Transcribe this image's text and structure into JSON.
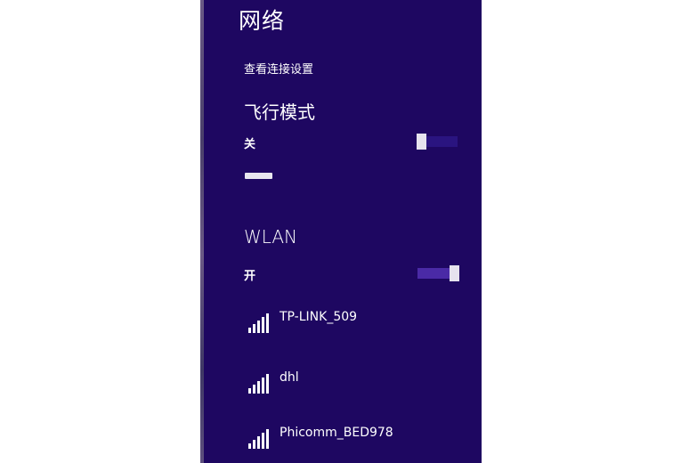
{
  "panel": {
    "title": "网络",
    "view_settings_link": "查看连接设置"
  },
  "airplane_mode": {
    "label": "飞行模式",
    "state_text": "关"
  },
  "wlan": {
    "label": "WLAN",
    "state_text": "开",
    "networks": [
      {
        "name": "TP-LINK_509",
        "icon": "wifi-signal-icon"
      },
      {
        "name": "dhl",
        "icon": "wifi-signal-icon"
      },
      {
        "name": "Phicomm_BED978",
        "icon": "wifi-signal-icon"
      }
    ]
  },
  "colors": {
    "panel_background": "#1e0761",
    "text": "#ffffff",
    "toggle_thumb": "#e6e3ee",
    "toggle_on_track": "#4a2aa6"
  }
}
